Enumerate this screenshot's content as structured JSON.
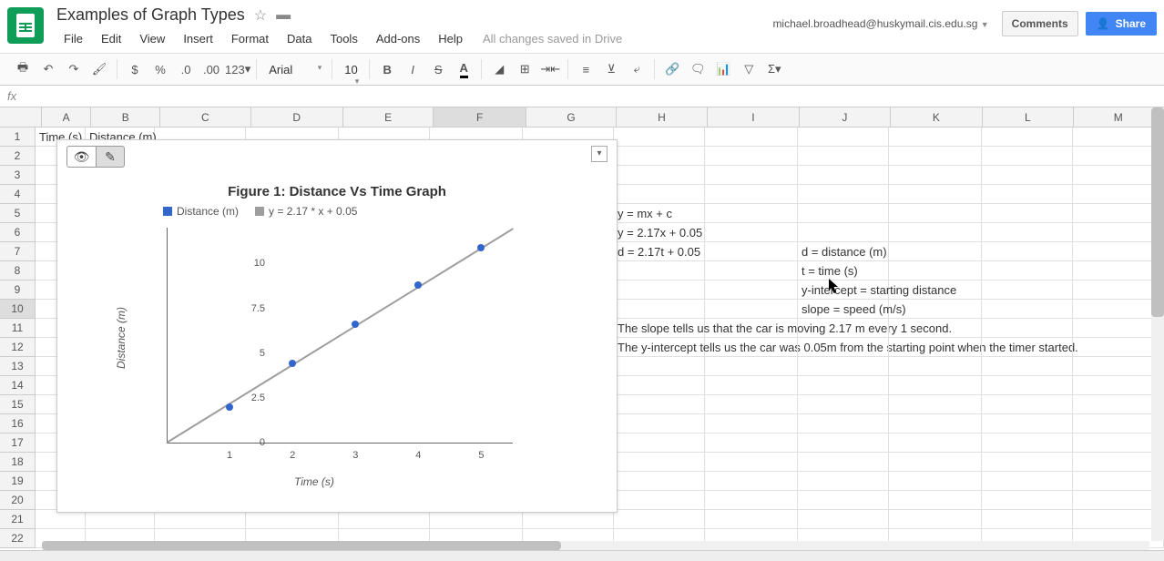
{
  "header": {
    "doc_title": "Examples of Graph Types",
    "user_email": "michael.broadhead@huskymail.cis.edu.sg",
    "menus": [
      "File",
      "Edit",
      "View",
      "Insert",
      "Format",
      "Data",
      "Tools",
      "Add-ons",
      "Help"
    ],
    "drive_status": "All changes saved in Drive",
    "comments_label": "Comments",
    "share_label": "Share"
  },
  "toolbar": {
    "number_123": "123",
    "font_name": "Arial",
    "font_size": "10"
  },
  "formula_bar": {
    "value": ""
  },
  "columns": [
    "A",
    "B",
    "C",
    "D",
    "E",
    "F",
    "G",
    "H",
    "I",
    "J",
    "K",
    "L",
    "M"
  ],
  "rows": 22,
  "selected_col": "F",
  "selected_row": 10,
  "cells": {
    "A1": "Time (s)",
    "B1": "Distance (m)",
    "H5": "y = mx + c",
    "H6": "y = 2.17x + 0.05",
    "H7": "d = 2.17t + 0.05",
    "J7": "d = distance (m)",
    "J8": "t = time (s)",
    "J9": "y-intercept = starting distance",
    "J10": "slope = speed (m/s)",
    "H11": "The slope tells us that the car is moving 2.17 m every 1 second.",
    "H12": "The y-intercept tells us the car was 0.05m from the starting point when the timer started."
  },
  "chart_data": {
    "type": "scatter",
    "title": "Figure 1: Distance Vs Time Graph",
    "xlabel": "Time (s)",
    "ylabel": "Distance (m)",
    "xlim": [
      0,
      5.5
    ],
    "ylim": [
      0,
      12
    ],
    "x": [
      1,
      2,
      3,
      4,
      5
    ],
    "y": [
      2.0,
      4.4,
      6.6,
      8.8,
      10.9
    ],
    "series": [
      {
        "name": "Distance (m)",
        "color": "#3366cc"
      },
      {
        "name": "y = 2.17 * x + 0.05",
        "color": "#9e9e9e"
      }
    ],
    "trendline": {
      "slope": 2.17,
      "intercept": 0.05
    },
    "xticks": [
      1,
      2,
      3,
      4,
      5
    ],
    "yticks": [
      0,
      2.5,
      5,
      7.5,
      10
    ]
  }
}
